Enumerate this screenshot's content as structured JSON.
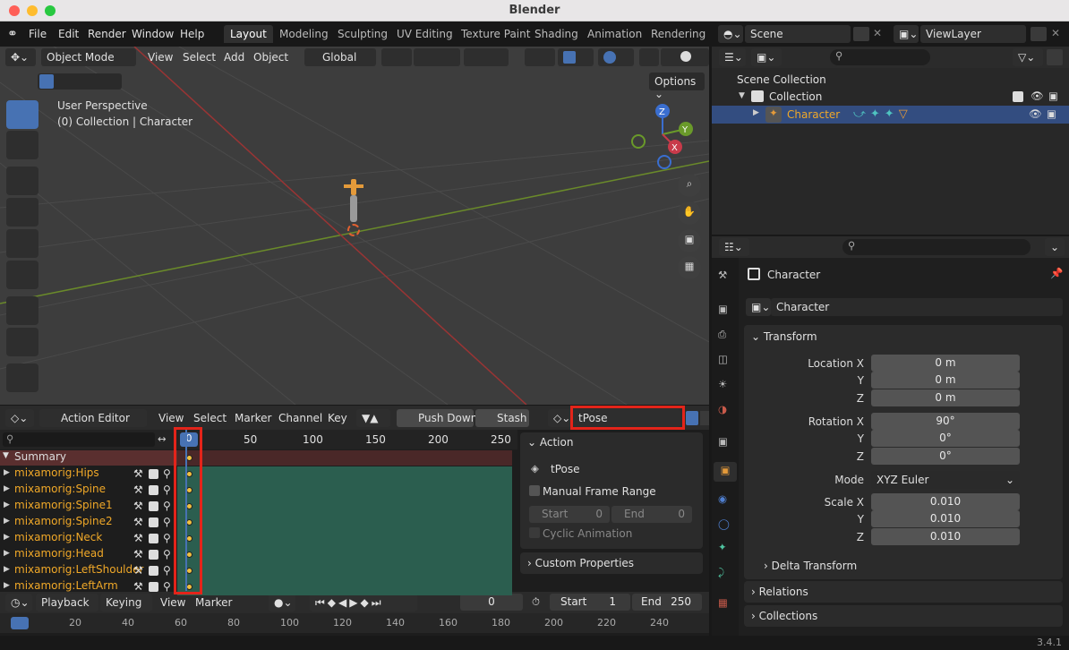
{
  "window": {
    "title": "Blender",
    "version": "3.4.1"
  },
  "menu": [
    "File",
    "Edit",
    "Render",
    "Window",
    "Help"
  ],
  "workspace_tabs": [
    "Layout",
    "Modeling",
    "Sculpting",
    "UV Editing",
    "Texture Paint",
    "Shading",
    "Animation",
    "Rendering"
  ],
  "scene": {
    "scene_name": "Scene",
    "view_layer": "ViewLayer"
  },
  "viewport": {
    "mode": "Object Mode",
    "menus": [
      "View",
      "Select",
      "Add",
      "Object"
    ],
    "transform_orientation": "Global",
    "options_label": "Options",
    "perspective_label": "User Perspective",
    "collection_label": "(0) Collection | Character",
    "axis_labels": {
      "z": "Z",
      "y": "Y",
      "x": "X"
    }
  },
  "outliner": {
    "root": "Scene Collection",
    "collection": "Collection",
    "object": "Character"
  },
  "properties": {
    "object_title": "Character",
    "object_name": "Character",
    "transform_label": "Transform",
    "location_label": "Location X",
    "rotation_label": "Rotation X",
    "scale_label": "Scale X",
    "axis_y": "Y",
    "axis_z": "Z",
    "location": [
      "0 m",
      "0 m",
      "0 m"
    ],
    "rotation": [
      "90°",
      "0°",
      "0°"
    ],
    "mode_label": "Mode",
    "mode_value": "XYZ Euler",
    "scale": [
      "0.010",
      "0.010",
      "0.010"
    ],
    "delta_transform": "Delta Transform",
    "relations": "Relations",
    "collections": "Collections"
  },
  "action_editor": {
    "mode": "Action Editor",
    "menus": [
      "View",
      "Select",
      "Marker",
      "Channel",
      "Key"
    ],
    "push_down": "Push Down",
    "stash": "Stash",
    "action_name": "tPose",
    "current_frame": "0",
    "ruler": [
      "50",
      "100",
      "150",
      "200",
      "250"
    ],
    "summary": "Summary",
    "channels": [
      "mixamorig:Hips",
      "mixamorig:Spine",
      "mixamorig:Spine1",
      "mixamorig:Spine2",
      "mixamorig:Neck",
      "mixamorig:Head",
      "mixamorig:LeftShoulder",
      "mixamorig:LeftArm"
    ],
    "side_panel": {
      "action_header": "Action",
      "action_name": "tPose",
      "manual_frame_range": "Manual Frame Range",
      "start_label": "Start",
      "start_value": "0",
      "end_label": "End",
      "end_value": "0",
      "cyclic": "Cyclic Animation",
      "custom_properties": "Custom Properties"
    }
  },
  "timeline": {
    "menus": [
      "Playback",
      "Keying",
      "View",
      "Marker"
    ],
    "current_frame": "0",
    "start_label": "Start",
    "start": "1",
    "end_label": "End",
    "end": "250",
    "ticks": [
      "0",
      "20",
      "40",
      "60",
      "80",
      "100",
      "120",
      "140",
      "160",
      "180",
      "200",
      "220",
      "240"
    ]
  },
  "colors": {
    "accent": "#4772b3",
    "highlight": "#e3241a",
    "channel": "#f0a828",
    "track": "#2b5e4f"
  }
}
